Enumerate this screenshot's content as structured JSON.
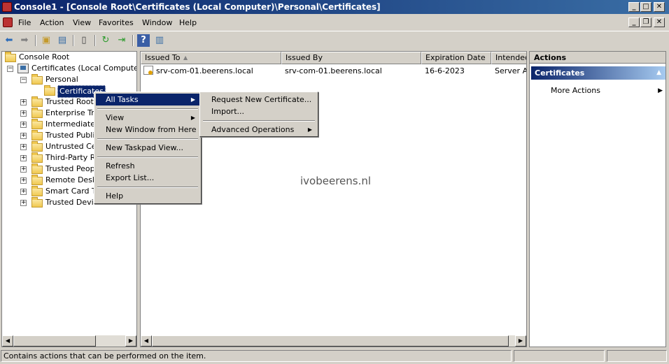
{
  "window": {
    "title": "Console1 - [Console Root\\Certificates (Local Computer)\\Personal\\Certificates]",
    "minimize_glyph": "_",
    "maximize_glyph": "□",
    "close_glyph": "✕",
    "restore_glyph": "❐"
  },
  "menubar": {
    "items": [
      "File",
      "Action",
      "View",
      "Favorites",
      "Window",
      "Help"
    ]
  },
  "toolbar": {
    "icons": [
      "back-arrow-icon",
      "forward-arrow-icon",
      "up-folder-icon",
      "show-hide-tree-icon",
      "properties-icon",
      "refresh-icon",
      "export-icon",
      "help-icon",
      "show-hide-action-pane-icon"
    ]
  },
  "tree": {
    "console_root": "Console Root",
    "certificates_local": "Certificates (Local Computer)",
    "personal": "Personal",
    "certificates": "Certificates",
    "expander_plus": "+",
    "expander_minus": "−",
    "stores": [
      "Trusted Root C",
      "Enterprise Tru",
      "Intermediate C",
      "Trusted Publis",
      "Untrusted Cer",
      "Third-Party Ro",
      "Trusted People",
      "Remote Deskt",
      "Smart Card Tr",
      "Trusted Devices"
    ]
  },
  "list": {
    "columns": [
      "Issued To",
      "Issued By",
      "Expiration Date",
      "Intended"
    ],
    "sort_glyph": "▲",
    "rows": [
      {
        "issued_to": "srv-com-01.beerens.local",
        "issued_by": "srv-com-01.beerens.local",
        "expiration": "16-6-2023",
        "intended": "Server Au"
      }
    ]
  },
  "actions": {
    "header": "Actions",
    "section": "Certificates",
    "collapse_glyph": "▲",
    "items": [
      "More Actions"
    ],
    "submenu_glyph": "▶"
  },
  "context_menu": {
    "items": [
      "All Tasks",
      "View",
      "New Window from Here",
      "New Taskpad View...",
      "Refresh",
      "Export List...",
      "Help"
    ],
    "submenu_glyph": "▶"
  },
  "submenu": {
    "items": [
      "Request New Certificate...",
      "Import...",
      "Advanced Operations"
    ],
    "submenu_glyph": "▶"
  },
  "scrollbar": {
    "left_glyph": "◀",
    "right_glyph": "▶"
  },
  "watermark": "ivobeerens.nl",
  "statusbar": {
    "text": "Contains actions that can be performed on the item."
  },
  "colors": {
    "title_start": "#0a246a",
    "title_end": "#3a6ea5",
    "selection": "#0a246a",
    "chrome": "#d4d0c8"
  }
}
